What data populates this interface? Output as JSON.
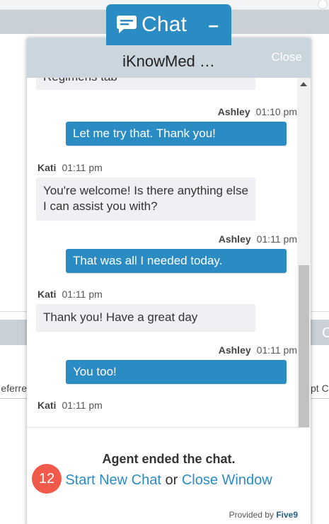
{
  "background": {
    "left_text": "eferre",
    "right_text": "pt C",
    "band_letter": "C"
  },
  "chat_tab": {
    "icon": "chat-bubble-icon",
    "title": "Chat",
    "minimize": "–"
  },
  "header": {
    "title": "iKnowMed …",
    "close": "Close"
  },
  "partial_message": "Regimens tab",
  "messages": [
    {
      "sender": "Ashley",
      "time": "01:10 pm",
      "side": "right",
      "text": "Let me try that. Thank you!"
    },
    {
      "sender": "Kati",
      "time": "01:11 pm",
      "side": "left",
      "text": "You're welcome! Is there anything else I can assist you with?"
    },
    {
      "sender": "Ashley",
      "time": "01:11 pm",
      "side": "right",
      "text": "That was all I needed today."
    },
    {
      "sender": "Kati",
      "time": "01:11 pm",
      "side": "left",
      "text": "Thank you! Have a great day"
    },
    {
      "sender": "Ashley",
      "time": "01:11 pm",
      "side": "right",
      "text": "You too!"
    },
    {
      "sender": "Kati",
      "time": "01:11 pm",
      "side": "left",
      "text": ""
    }
  ],
  "footer": {
    "status": "Agent ended the chat.",
    "start_new": "Start New Chat",
    "or": "or",
    "close_window": "Close Window",
    "provided_by": "Provided by",
    "brand": "Five9"
  },
  "badge": "12",
  "colors": {
    "accent": "#2b8cc4",
    "header": "#c9d6de",
    "agent_bubble": "#eef0f4",
    "badge": "#f15a4a"
  }
}
